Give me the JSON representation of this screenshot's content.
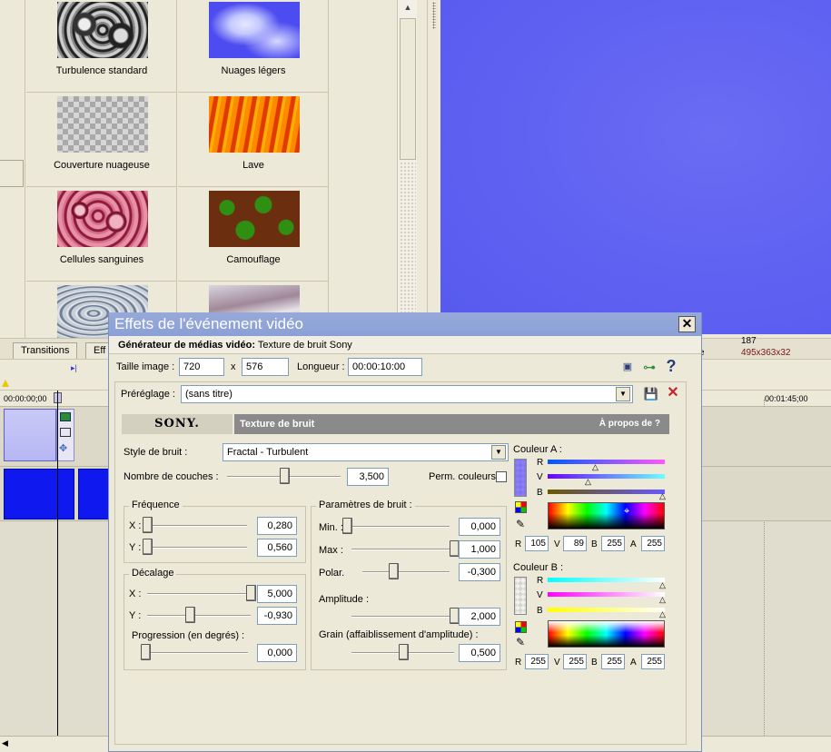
{
  "generators": [
    {
      "label": "Turbulence standard",
      "texture": "turbulence"
    },
    {
      "label": "Nuages légers",
      "texture": "clouds"
    },
    {
      "label": "Couverture nuageuse",
      "texture": "checker"
    },
    {
      "label": "Lave",
      "texture": "lava"
    },
    {
      "label": "Cellules sanguines",
      "texture": "blood"
    },
    {
      "label": "Camouflage",
      "texture": "camo"
    }
  ],
  "preview": {
    "info_frame": "187",
    "info_prefix": "e",
    "info_size": "495x363x32"
  },
  "tabs": [
    {
      "label": "Transitions"
    },
    {
      "label": "Eff"
    }
  ],
  "timeline": {
    "timecode_start": "00:00:00;00",
    "timecode_end": "00:01:45;00"
  },
  "dialog": {
    "title": "Effets de l'événement vidéo",
    "close": "✕",
    "generator_label": "Générateur de médias vidéo:",
    "generator_name": "Texture de bruit Sony",
    "frame_size_label": "Taille image :",
    "width": "720",
    "times": "x",
    "height": "576",
    "length_label": "Longueur :",
    "length": "00:00:10:00",
    "preset_label": "Préréglage :",
    "preset_value": "(sans titre)",
    "brand": "SONY.",
    "plugin_name": "Texture de bruit",
    "about": "À propos de ?",
    "noise_style_label": "Style de bruit :",
    "noise_style": "Fractal - Turbulent",
    "layers_label": "Nombre de couches :",
    "layers_value": "3,500",
    "layers_slider": 0.5,
    "perm_colors_label": "Perm. couleurs",
    "frequency": {
      "title": "Fréquence",
      "x_label": "X :",
      "x_value": "0,280",
      "x_slider": 0.0,
      "y_label": "Y :",
      "y_value": "0,560",
      "y_slider": 0.0
    },
    "offset": {
      "title": "Décalage",
      "x_label": "X :",
      "x_value": "5,000",
      "x_slider": 1.0,
      "y_label": "Y :",
      "y_value": "-0,930",
      "y_slider": 0.41,
      "progress_label": "Progression (en degrés) :",
      "progress_value": "0,000",
      "progress_slider": 0.0
    },
    "noise_params": {
      "title": "Paramètres de bruit :",
      "min_label": "Min. :",
      "min_value": "0,000",
      "min_slider": 0.0,
      "max_label": "Max :",
      "max_value": "1,000",
      "max_slider": 1.0,
      "polar_label": "Polar.",
      "polar_value": "-0,300",
      "polar_slider": 0.35,
      "amp_label": "Amplitude :",
      "amp_value": "2,000",
      "amp_slider": 1.0,
      "grain_label": "Grain (affaiblissement d'amplitude) :",
      "grain_value": "0,500",
      "grain_slider": 0.5
    },
    "color_a": {
      "title": "Couleur A :",
      "swatch": "#6959ff",
      "r_label": "R",
      "r": "105",
      "v_label": "V",
      "v": "89",
      "b_label": "B",
      "b": "255",
      "a_label": "A",
      "a": "255"
    },
    "color_b": {
      "title": "Couleur B :",
      "swatch": "#ffffff",
      "r_label": "R",
      "r": "255",
      "v_label": "V",
      "v": "255",
      "b_label": "B",
      "b": "255",
      "a_label": "A",
      "a": "255"
    }
  }
}
